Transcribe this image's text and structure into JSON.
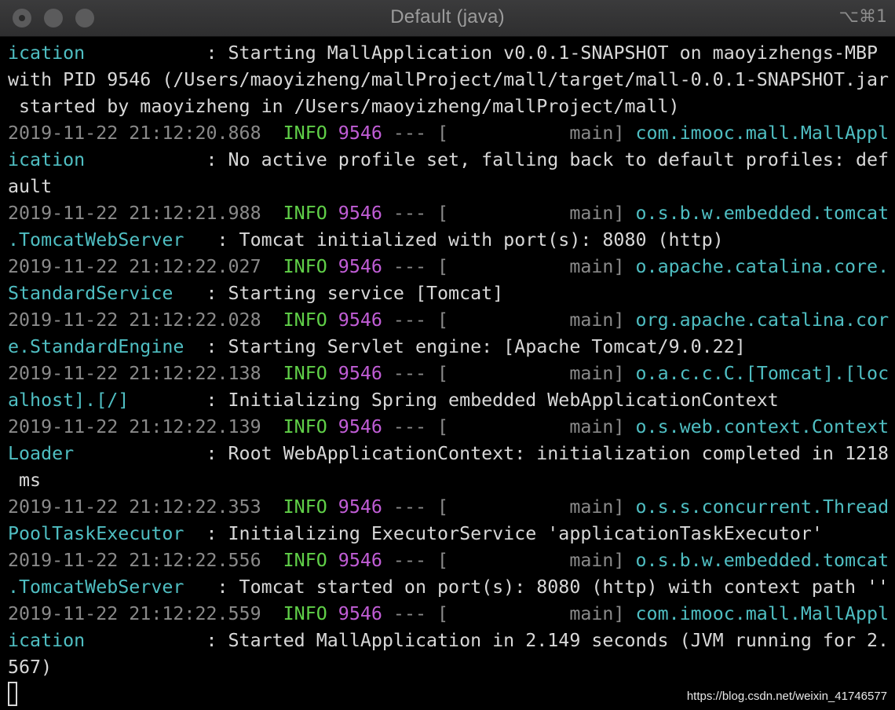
{
  "window": {
    "title": "Default (java)",
    "shortcut": "⌥⌘1"
  },
  "terminal": {
    "lines": [
      [
        {
          "c": "cls",
          "t": "ication          "
        },
        {
          "c": "msg",
          "t": " : Starting MallApplication v0.0.1-SNAPSHOT on maoyizhengs-MBP"
        }
      ],
      [
        {
          "c": "msg",
          "t": "with PID 9546 (/Users/maoyizheng/mallProject/mall/target/mall-0.0.1-SNAPSHOT.jar"
        }
      ],
      [
        {
          "c": "msg",
          "t": " started by maoyizheng in /Users/maoyizheng/mallProject/mall)"
        }
      ],
      [
        {
          "c": "ts",
          "t": "2019-11-22 21:12:20.868  "
        },
        {
          "c": "info",
          "t": "INFO "
        },
        {
          "c": "pid",
          "t": "9546"
        },
        {
          "c": "sep",
          "t": " --- [           main] "
        },
        {
          "c": "cls",
          "t": "com.imooc.mall.MallAppl"
        }
      ],
      [
        {
          "c": "cls",
          "t": "ication          "
        },
        {
          "c": "msg",
          "t": " : No active profile set, falling back to default profiles: def"
        }
      ],
      [
        {
          "c": "msg",
          "t": "ault"
        }
      ],
      [
        {
          "c": "ts",
          "t": "2019-11-22 21:12:21.988  "
        },
        {
          "c": "info",
          "t": "INFO "
        },
        {
          "c": "pid",
          "t": "9546"
        },
        {
          "c": "sep",
          "t": " --- [           main] "
        },
        {
          "c": "cls",
          "t": "o.s.b.w.embedded.tomcat"
        }
      ],
      [
        {
          "c": "cls",
          "t": ".TomcatWebServer  "
        },
        {
          "c": "msg",
          "t": " : Tomcat initialized with port(s): 8080 (http)"
        }
      ],
      [
        {
          "c": "ts",
          "t": "2019-11-22 21:12:22.027  "
        },
        {
          "c": "info",
          "t": "INFO "
        },
        {
          "c": "pid",
          "t": "9546"
        },
        {
          "c": "sep",
          "t": " --- [           main] "
        },
        {
          "c": "cls",
          "t": "o.apache.catalina.core."
        }
      ],
      [
        {
          "c": "cls",
          "t": "StandardService  "
        },
        {
          "c": "msg",
          "t": " : Starting service [Tomcat]"
        }
      ],
      [
        {
          "c": "ts",
          "t": "2019-11-22 21:12:22.028  "
        },
        {
          "c": "info",
          "t": "INFO "
        },
        {
          "c": "pid",
          "t": "9546"
        },
        {
          "c": "sep",
          "t": " --- [           main] "
        },
        {
          "c": "cls",
          "t": "org.apache.catalina.cor"
        }
      ],
      [
        {
          "c": "cls",
          "t": "e.StandardEngine "
        },
        {
          "c": "msg",
          "t": " : Starting Servlet engine: [Apache Tomcat/9.0.22]"
        }
      ],
      [
        {
          "c": "ts",
          "t": "2019-11-22 21:12:22.138  "
        },
        {
          "c": "info",
          "t": "INFO "
        },
        {
          "c": "pid",
          "t": "9546"
        },
        {
          "c": "sep",
          "t": " --- [           main] "
        },
        {
          "c": "cls",
          "t": "o.a.c.c.C.[Tomcat].[loc"
        }
      ],
      [
        {
          "c": "cls",
          "t": "alhost].[/]      "
        },
        {
          "c": "msg",
          "t": " : Initializing Spring embedded WebApplicationContext"
        }
      ],
      [
        {
          "c": "ts",
          "t": "2019-11-22 21:12:22.139  "
        },
        {
          "c": "info",
          "t": "INFO "
        },
        {
          "c": "pid",
          "t": "9546"
        },
        {
          "c": "sep",
          "t": " --- [           main] "
        },
        {
          "c": "cls",
          "t": "o.s.web.context.Context"
        }
      ],
      [
        {
          "c": "cls",
          "t": "Loader           "
        },
        {
          "c": "msg",
          "t": " : Root WebApplicationContext: initialization completed in 1218"
        }
      ],
      [
        {
          "c": "msg",
          "t": " ms"
        }
      ],
      [
        {
          "c": "ts",
          "t": "2019-11-22 21:12:22.353  "
        },
        {
          "c": "info",
          "t": "INFO "
        },
        {
          "c": "pid",
          "t": "9546"
        },
        {
          "c": "sep",
          "t": " --- [           main] "
        },
        {
          "c": "cls",
          "t": "o.s.s.concurrent.Thread"
        }
      ],
      [
        {
          "c": "cls",
          "t": "PoolTaskExecutor "
        },
        {
          "c": "msg",
          "t": " : Initializing ExecutorService 'applicationTaskExecutor'"
        }
      ],
      [
        {
          "c": "ts",
          "t": "2019-11-22 21:12:22.556  "
        },
        {
          "c": "info",
          "t": "INFO "
        },
        {
          "c": "pid",
          "t": "9546"
        },
        {
          "c": "sep",
          "t": " --- [           main] "
        },
        {
          "c": "cls",
          "t": "o.s.b.w.embedded.tomcat"
        }
      ],
      [
        {
          "c": "cls",
          "t": ".TomcatWebServer  "
        },
        {
          "c": "msg",
          "t": " : Tomcat started on port(s): 8080 (http) with context path ''"
        }
      ],
      [
        {
          "c": "ts",
          "t": "2019-11-22 21:12:22.559  "
        },
        {
          "c": "info",
          "t": "INFO "
        },
        {
          "c": "pid",
          "t": "9546"
        },
        {
          "c": "sep",
          "t": " --- [           main] "
        },
        {
          "c": "cls",
          "t": "com.imooc.mall.MallAppl"
        }
      ],
      [
        {
          "c": "cls",
          "t": "ication          "
        },
        {
          "c": "msg",
          "t": " : Started MallApplication in 2.149 seconds (JVM running for 2."
        }
      ],
      [
        {
          "c": "msg",
          "t": "567)"
        }
      ]
    ]
  },
  "watermark": "https://blog.csdn.net/weixin_41746577",
  "colors": {
    "background": "#000000",
    "timestamp": "#8a8a8a",
    "info": "#60d048",
    "pid": "#c15dd6",
    "logger": "#4fbec2",
    "message": "#d8d8d8"
  }
}
